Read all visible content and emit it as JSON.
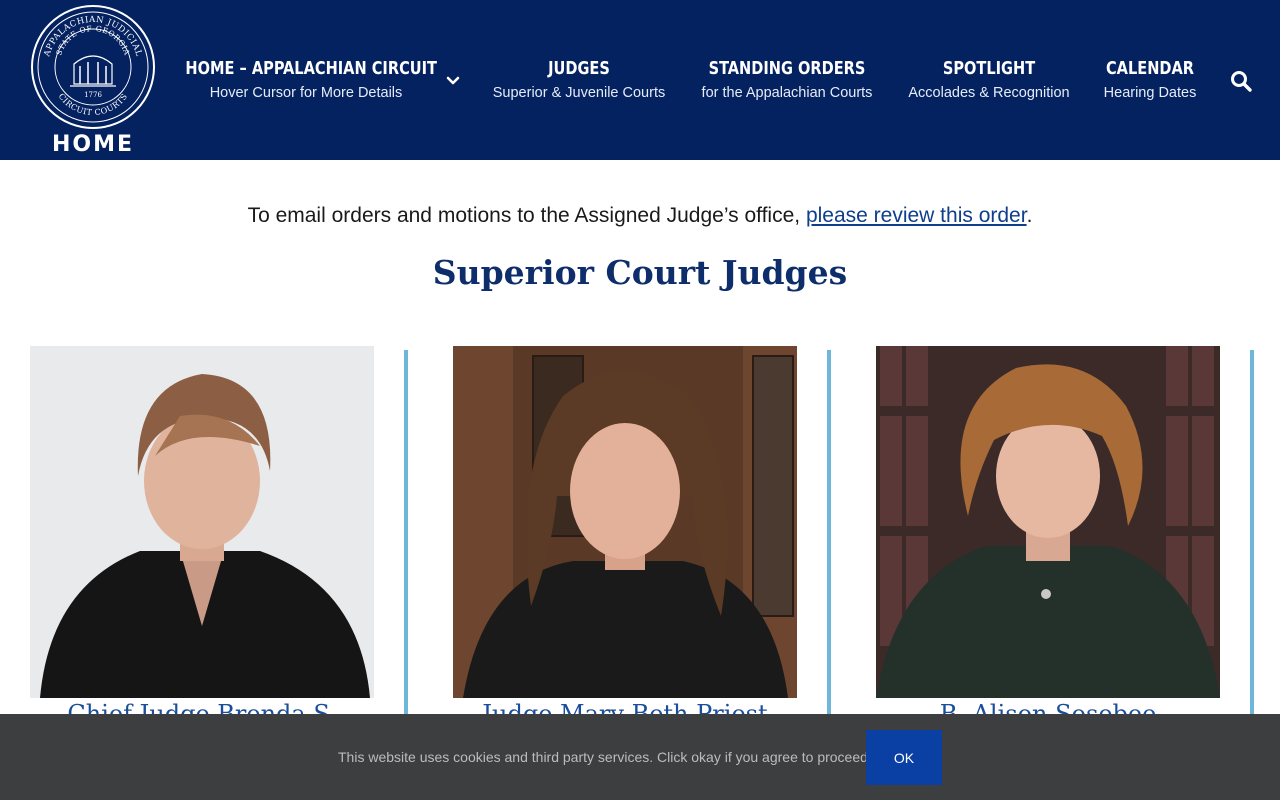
{
  "header": {
    "logo": {
      "seal_text_top": "APPALACHIAN JUDICIAL",
      "seal_text_state": "STATE OF GEORGIA",
      "seal_text_year": "1776",
      "seal_text_bottom": "CIRCUIT COURTS",
      "home_label": "HOME"
    },
    "nav": [
      {
        "title": "HOME – APPALACHIAN CIRCUIT",
        "subtitle": "Hover Cursor for More Details"
      },
      {
        "title": "JUDGES",
        "subtitle": "Superior & Juvenile Courts"
      },
      {
        "title": "STANDING ORDERS",
        "subtitle": "for the Appalachian Courts"
      },
      {
        "title": "SPOTLIGHT",
        "subtitle": "Accolades & Recognition"
      },
      {
        "title": "CALENDAR",
        "subtitle": "Hearing Dates"
      }
    ],
    "colors": {
      "background": "#042160",
      "text": "#ffffff"
    },
    "icons": {
      "dropdown": "chevron-down-icon",
      "search": "search-icon"
    }
  },
  "main": {
    "notice_text": "To email orders and motions to the Assigned Judge’s office, ",
    "notice_link": "please review this order",
    "notice_end": ".",
    "section_title": "Superior Court Judges",
    "judges": [
      {
        "name": "Chief Judge Brenda S."
      },
      {
        "name": "Judge Mary Beth Priest"
      },
      {
        "name": "B. Alison Sosebee"
      }
    ],
    "accent_color": "#6fb7da"
  },
  "cookie_bar": {
    "text": "This website uses cookies and third party services. Click okay if you agree to proceed.",
    "ok_label": "OK",
    "button_color": "#0a3fa3"
  }
}
